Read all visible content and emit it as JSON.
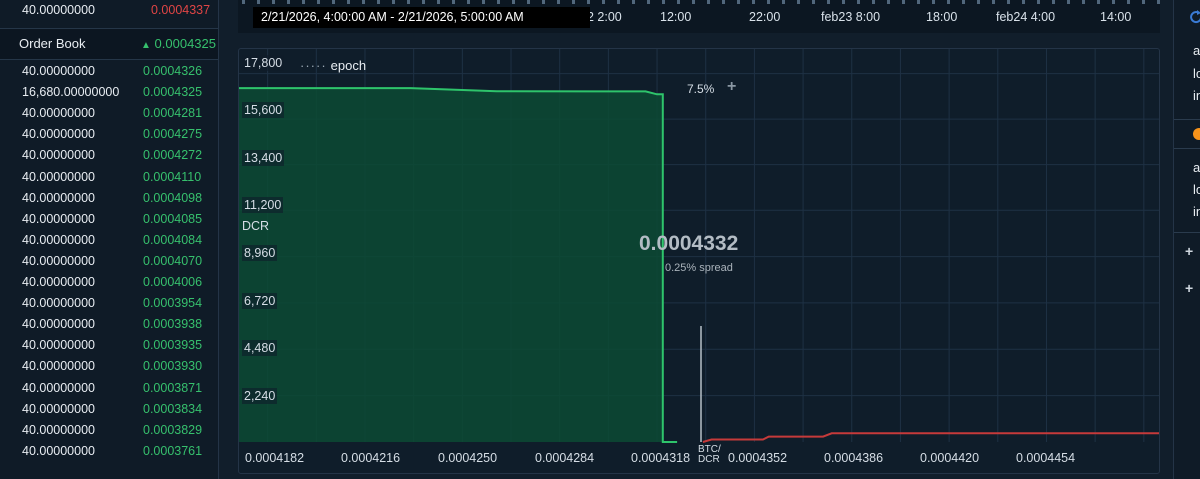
{
  "order_book": {
    "top_row": {
      "qty": "40.00000000",
      "price": "0.0004337"
    },
    "header": {
      "title": "Order Book",
      "mid_arrow": "▲",
      "mid_price": "0.0004325"
    },
    "rows": [
      {
        "qty": "40.00000000",
        "price": "0.0004326"
      },
      {
        "qty": "16,680.00000000",
        "price": "0.0004325"
      },
      {
        "qty": "40.00000000",
        "price": "0.0004281"
      },
      {
        "qty": "40.00000000",
        "price": "0.0004275"
      },
      {
        "qty": "40.00000000",
        "price": "0.0004272"
      },
      {
        "qty": "40.00000000",
        "price": "0.0004110"
      },
      {
        "qty": "40.00000000",
        "price": "0.0004098"
      },
      {
        "qty": "40.00000000",
        "price": "0.0004085"
      },
      {
        "qty": "40.00000000",
        "price": "0.0004084"
      },
      {
        "qty": "40.00000000",
        "price": "0.0004070"
      },
      {
        "qty": "40.00000000",
        "price": "0.0004006"
      },
      {
        "qty": "40.00000000",
        "price": "0.0003954"
      },
      {
        "qty": "40.00000000",
        "price": "0.0003938"
      },
      {
        "qty": "40.00000000",
        "price": "0.0003935"
      },
      {
        "qty": "40.00000000",
        "price": "0.0003930"
      },
      {
        "qty": "40.00000000",
        "price": "0.0003871"
      },
      {
        "qty": "40.00000000",
        "price": "0.0003834"
      },
      {
        "qty": "40.00000000",
        "price": "0.0003829"
      },
      {
        "qty": "40.00000000",
        "price": "0.0003761"
      }
    ]
  },
  "time_strip": {
    "tooltip": "2/21/2026, 4:00:00 AM - 2/21/2026, 5:00:00 AM",
    "labels": [
      "2 2:00",
      "12:00",
      "22:00",
      "feb23 8:00",
      "18:00",
      "feb24 4:00",
      "14:00"
    ]
  },
  "depth_chart": {
    "legend": {
      "dots": "·····",
      "label": "epoch"
    },
    "unit": "DCR",
    "y_ticks": [
      "17,800",
      "15,600",
      "13,400",
      "11,200",
      "8,960",
      "6,720",
      "4,480",
      "2,240"
    ],
    "x_ticks": [
      "0.0004182",
      "0.0004216",
      "0.0004250",
      "0.0004284",
      "0.0004318",
      "0.0004352",
      "0.0004386",
      "0.0004420",
      "0.0004454"
    ],
    "pair_label": [
      "BTC/",
      "DCR"
    ],
    "mid_price": "0.0004332",
    "spread": "0.25% spread",
    "zoom_pct": "7.5%",
    "zoom_icon": "plus-icon",
    "colors": {
      "buy": "#2ec46b",
      "buy_fill": "#0c4a34",
      "sell": "#c63a3a"
    }
  },
  "chart_data": {
    "type": "area",
    "xlabel": "BTC/DCR",
    "ylabel": "DCR",
    "xlim": [
      0.0004172,
      0.0004494
    ],
    "ylim": [
      0,
      18120
    ],
    "series": [
      {
        "x": [
          0.0004172,
          0.0004232,
          0.0004262,
          0.0004296,
          0.0004314,
          0.0004318,
          0.000432,
          0.000432,
          0.0004325
        ],
        "y": [
          17100,
          17100,
          16950,
          16940,
          16940,
          16800,
          16800,
          0,
          0
        ]
      },
      {
        "x": [
          0.0004334,
          0.0004337,
          0.0004355,
          0.0004357,
          0.0004376,
          0.0004379,
          0.0004494
        ],
        "y": [
          0,
          120,
          120,
          260,
          260,
          420,
          420
        ]
      }
    ]
  },
  "right_panel": {
    "texts": [
      "a",
      "lo",
      "in",
      "a",
      "lo",
      "in"
    ],
    "refresh_icon": "refresh-icon",
    "coin_icon": "coin-icon",
    "plus_icon": "plus-icon"
  }
}
